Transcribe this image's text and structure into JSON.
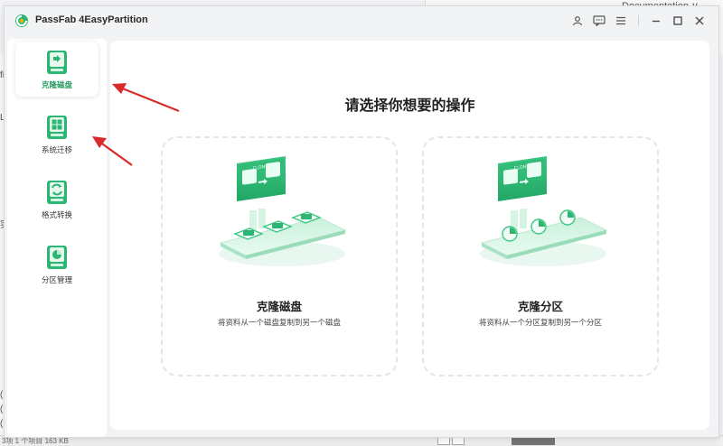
{
  "app": {
    "title": "PassFab 4EasyPartition",
    "brand_color": "#2bb673"
  },
  "background_app": {
    "right_text": "Documentation ∨",
    "left_chars": [
      "fic",
      "Lo",
      "实",
      "(I",
      "(I",
      "(I"
    ],
    "bottom_text": "3项  1 个项目  163 KB"
  },
  "titlebar": {
    "icons": [
      "user-icon",
      "feedback-icon",
      "menu-icon",
      "minimize-icon",
      "maximize-icon",
      "close-icon"
    ]
  },
  "sidebar": {
    "items": [
      {
        "label": "克隆磁盘",
        "icon": "clone-disk-icon",
        "active": true
      },
      {
        "label": "系统迁移",
        "icon": "system-migrate-icon",
        "active": false
      },
      {
        "label": "格式转换",
        "icon": "format-convert-icon",
        "active": false
      },
      {
        "label": "分区管理",
        "icon": "partition-manage-icon",
        "active": false
      }
    ]
  },
  "main": {
    "heading": "请选择你想要的操作",
    "cards": [
      {
        "title": "克隆磁盘",
        "desc": "将资料从一个磁盘复制到另一个磁盘",
        "badge": "CLONE"
      },
      {
        "title": "克隆分区",
        "desc": "将资料从一个分区复制到另一个分区",
        "badge": "CLONE"
      }
    ]
  },
  "annotations": {
    "arrow_color": "#d92b2b"
  }
}
